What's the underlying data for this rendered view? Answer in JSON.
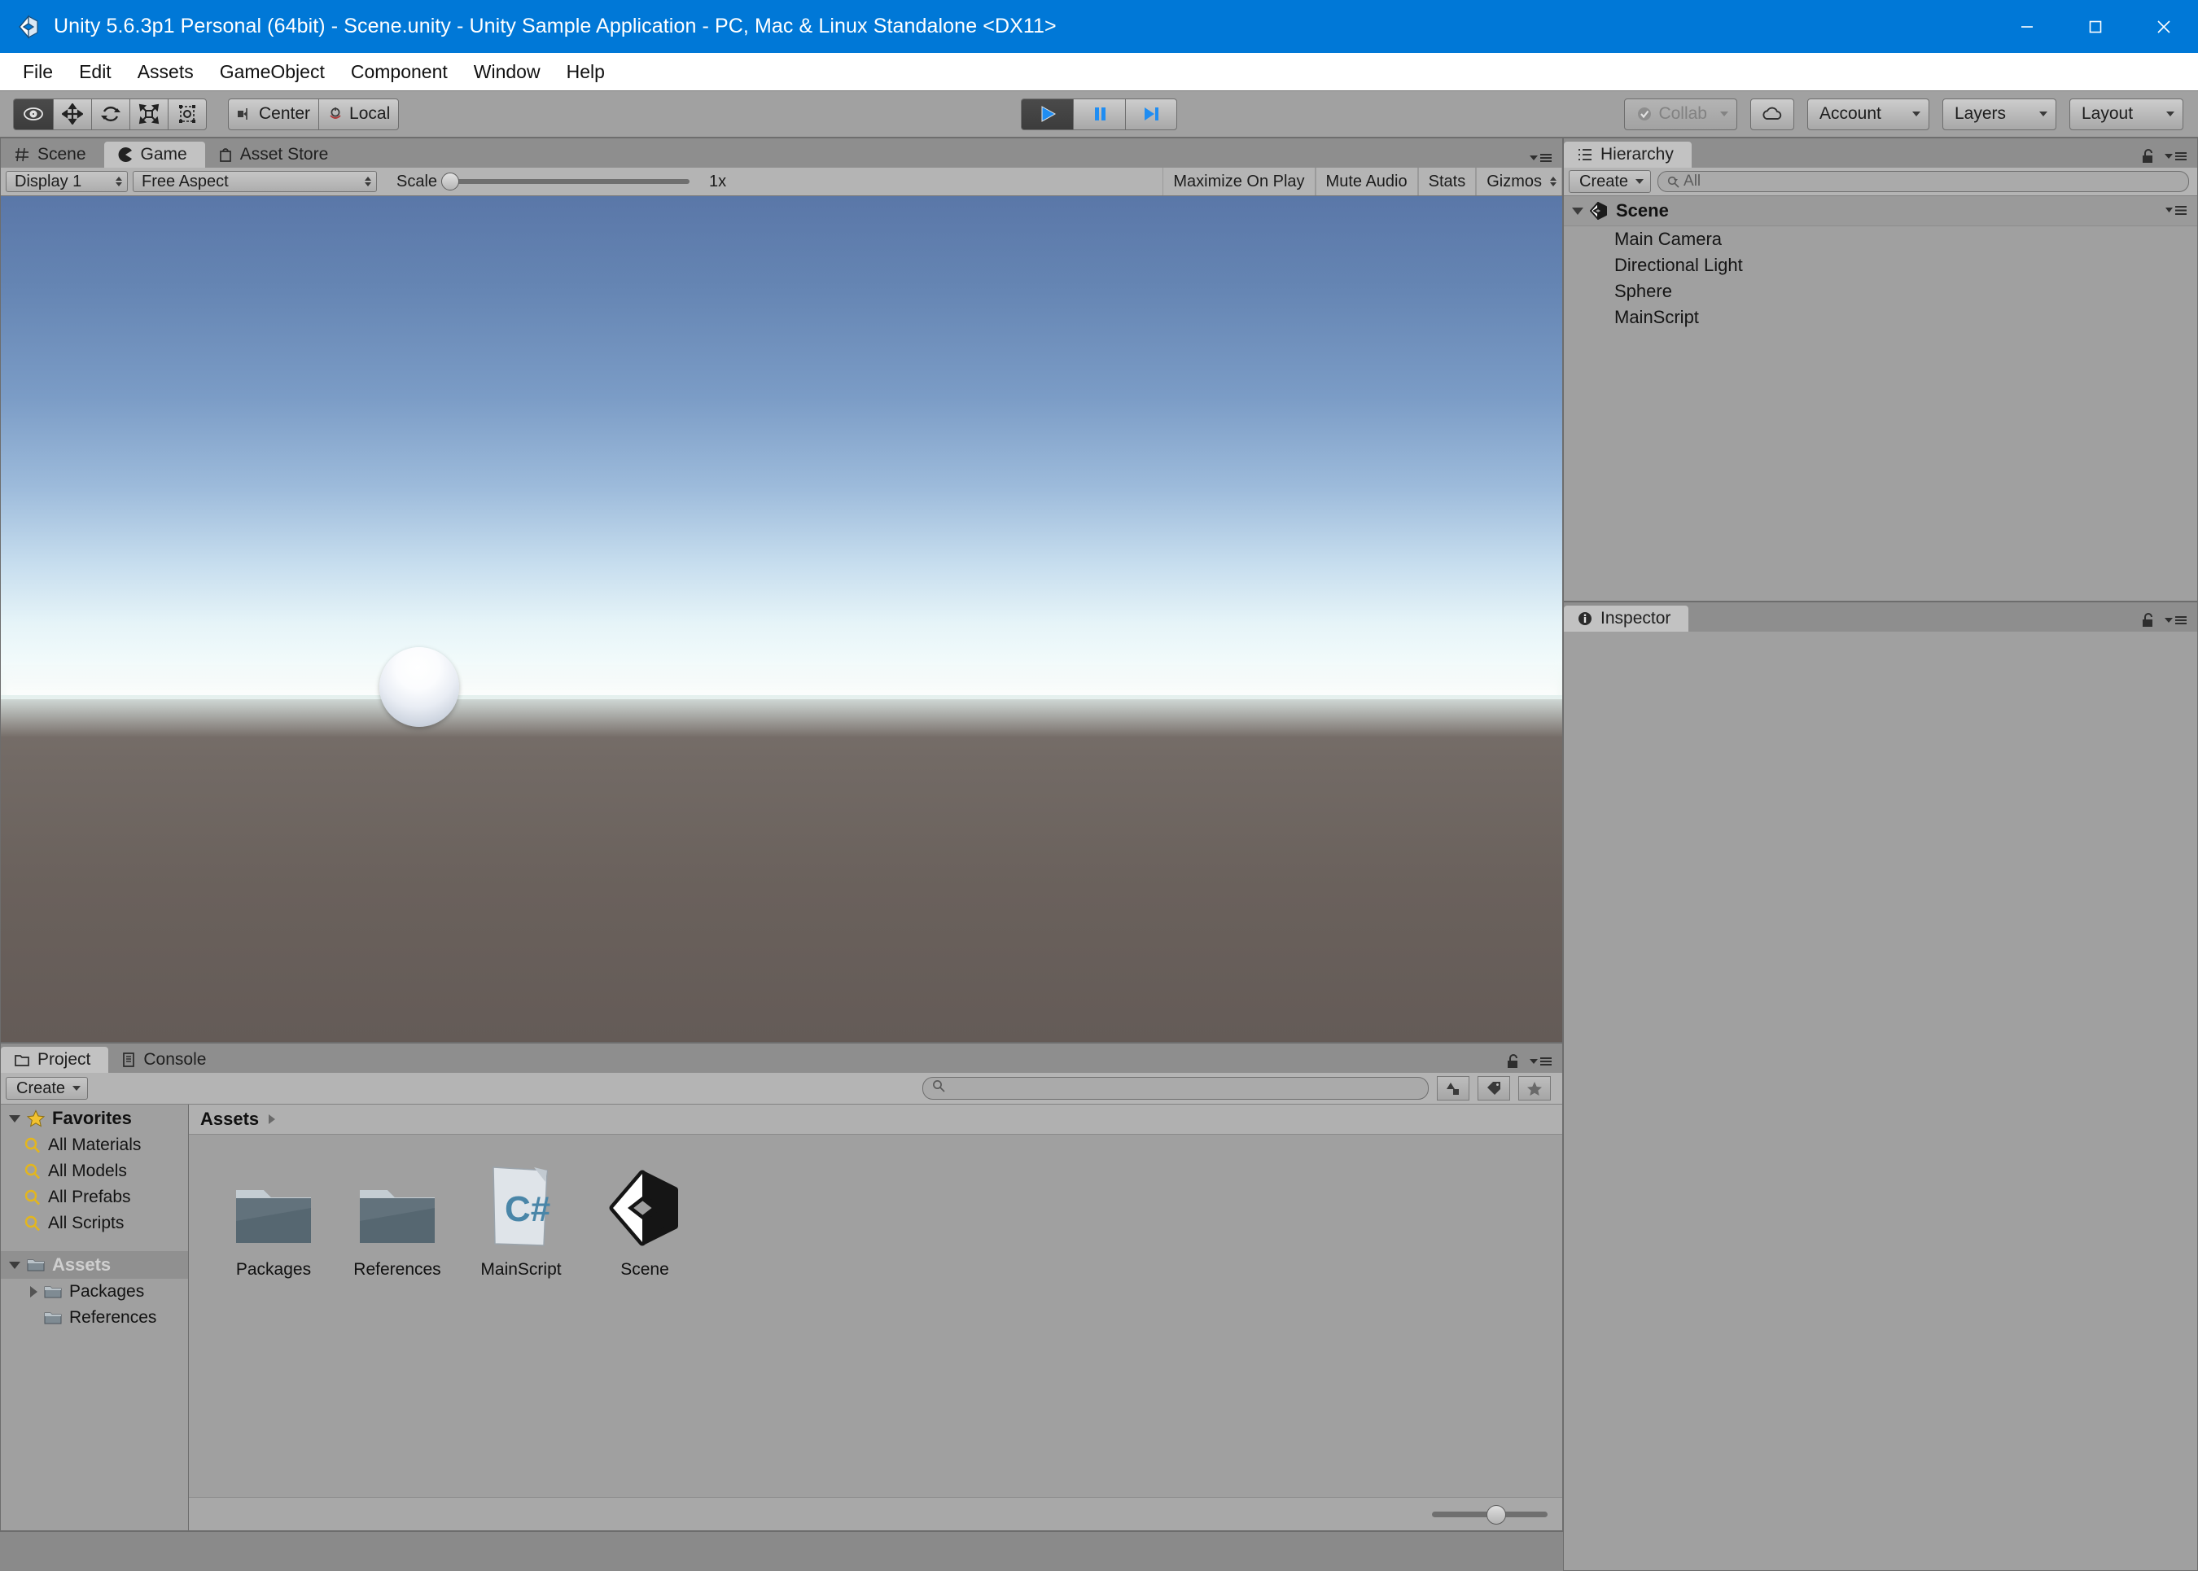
{
  "window": {
    "title": "Unity 5.6.3p1 Personal (64bit) - Scene.unity - Unity Sample Application - PC, Mac & Linux Standalone <DX11>",
    "app_icon": "unity-icon",
    "accent_color": "#0078d7",
    "controls": [
      {
        "name": "minimize-button",
        "glyph": "minimize-icon"
      },
      {
        "name": "maximize-button",
        "glyph": "maximize-icon"
      },
      {
        "name": "close-button",
        "glyph": "close-icon"
      }
    ]
  },
  "menubar": {
    "items": [
      {
        "label": "File"
      },
      {
        "label": "Edit"
      },
      {
        "label": "Assets"
      },
      {
        "label": "GameObject"
      },
      {
        "label": "Component"
      },
      {
        "label": "Window"
      },
      {
        "label": "Help"
      }
    ]
  },
  "toolbar": {
    "transform_tools": [
      {
        "name": "hand-tool",
        "icon": "hand-eye-icon",
        "active": true
      },
      {
        "name": "move-tool",
        "icon": "move-arrows-icon",
        "active": false
      },
      {
        "name": "rotate-tool",
        "icon": "rotate-icon",
        "active": false
      },
      {
        "name": "scale-tool",
        "icon": "scale-icon",
        "active": false
      },
      {
        "name": "rect-tool",
        "icon": "rect-transform-icon",
        "active": false
      }
    ],
    "pivot_label": "Center",
    "pivot_icon": "pivot-center-icon",
    "space_label": "Local",
    "space_icon": "handle-local-icon",
    "playback": [
      {
        "name": "play-button",
        "icon": "play-icon",
        "active": true
      },
      {
        "name": "pause-button",
        "icon": "pause-icon",
        "active": false
      },
      {
        "name": "step-button",
        "icon": "step-icon",
        "active": false
      }
    ],
    "collab_label": "Collab",
    "collab_icon": "collab-check-icon",
    "collab_disabled": true,
    "cloud_icon": "cloud-icon",
    "account_label": "Account",
    "layers_label": "Layers",
    "layout_label": "Layout"
  },
  "game_panel": {
    "tabs": [
      {
        "label": "Scene",
        "icon": "scene-grid-icon",
        "active": false
      },
      {
        "label": "Game",
        "icon": "game-pacman-icon",
        "active": true
      },
      {
        "label": "Asset Store",
        "icon": "asset-store-bag-icon",
        "active": false
      }
    ],
    "display_label": "Display 1",
    "aspect_label": "Free Aspect",
    "scale_label": "Scale",
    "scale_value": "1x",
    "scale_percent": 0,
    "maximize_label": "Maximize On Play",
    "mute_label": "Mute Audio",
    "stats_label": "Stats",
    "gizmos_label": "Gizmos",
    "render": {
      "sky_top_color": "#5a77a8",
      "horizon_color": "#f2fbfb",
      "ground_color": "#6e6560",
      "object_name": "Sphere",
      "object_color": "#ffffff"
    }
  },
  "hierarchy": {
    "tab_label": "Hierarchy",
    "tab_icon": "hierarchy-list-icon",
    "lock_icon": "padlock-open-icon",
    "menu_icon": "panel-menu-icon",
    "create_label": "Create",
    "search_placeholder": "All",
    "search_icon": "search-icon",
    "scene_label": "Scene",
    "scene_icon": "unity-scene-icon",
    "items": [
      {
        "label": "Main Camera"
      },
      {
        "label": "Directional Light"
      },
      {
        "label": "Sphere"
      },
      {
        "label": "MainScript"
      }
    ]
  },
  "inspector": {
    "tab_label": "Inspector",
    "tab_icon": "inspector-info-icon",
    "lock_icon": "padlock-open-icon",
    "menu_icon": "panel-menu-icon"
  },
  "project": {
    "tabs": [
      {
        "label": "Project",
        "icon": "project-folder-icon",
        "active": true
      },
      {
        "label": "Console",
        "icon": "console-icon",
        "active": false
      }
    ],
    "lock_icon": "padlock-open-icon",
    "menu_icon": "panel-menu-icon",
    "create_label": "Create",
    "search_placeholder": "",
    "search_icon": "search-icon",
    "filter_buttons": [
      {
        "name": "filter-by-type-button",
        "icon": "type-filter-icon"
      },
      {
        "name": "filter-by-label-button",
        "icon": "label-tag-icon"
      },
      {
        "name": "save-search-button",
        "icon": "star-icon"
      }
    ],
    "favorites_label": "Favorites",
    "favorites_icon": "star-icon",
    "favorites": [
      {
        "label": "All Materials",
        "icon": "search-icon"
      },
      {
        "label": "All Models",
        "icon": "search-icon"
      },
      {
        "label": "All Prefabs",
        "icon": "search-icon"
      },
      {
        "label": "All Scripts",
        "icon": "search-icon"
      }
    ],
    "assets_root_label": "Assets",
    "assets_root_icon": "folder-icon",
    "tree": [
      {
        "label": "Packages",
        "icon": "folder-icon",
        "expandable": true
      },
      {
        "label": "References",
        "icon": "folder-icon",
        "expandable": false
      }
    ],
    "breadcrumb": "Assets",
    "grid_items": [
      {
        "label": "Packages",
        "icon": "folder-icon"
      },
      {
        "label": "References",
        "icon": "folder-icon"
      },
      {
        "label": "MainScript",
        "icon": "csharp-script-icon"
      },
      {
        "label": "Scene",
        "icon": "unity-scene-icon"
      }
    ],
    "zoom_percent": 55
  }
}
